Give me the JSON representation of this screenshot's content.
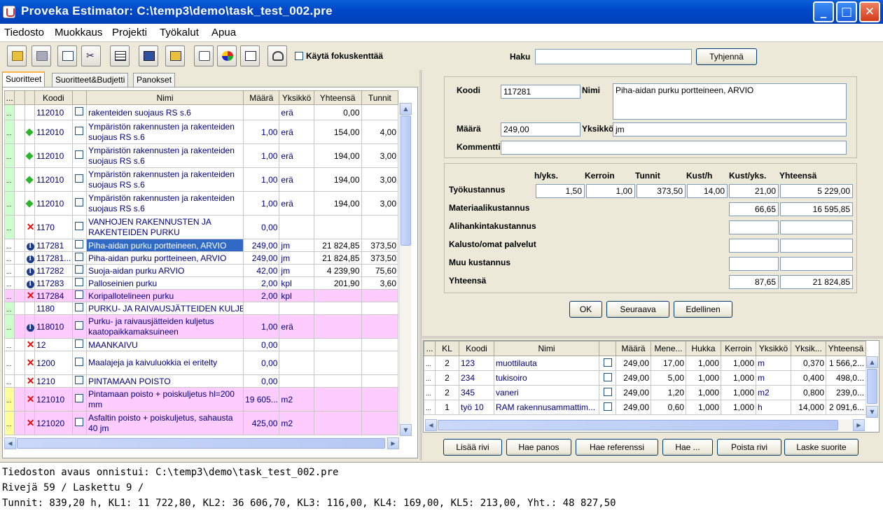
{
  "window": {
    "title": "Proveka Estimator: C:\\temp3\\demo\\task_test_002.pre"
  },
  "menu": [
    "Tiedosto",
    "Muokkaus",
    "Projekti",
    "Työkalut",
    "Apua"
  ],
  "toolbar": {
    "focus_label": "Käytä fokuskenttää",
    "search_label": "Haku",
    "search_value": "",
    "clear_label": "Tyhjennä"
  },
  "tabs": [
    "Suoritteet",
    "Suoritteet&Budjetti",
    "Panokset"
  ],
  "main_table": {
    "columns": [
      "...",
      "",
      "",
      "Koodi",
      "",
      "Nimi",
      "Määrä",
      "Yksikkö",
      "Yhteensä",
      "Tunnit"
    ],
    "rows": [
      {
        "lvl": "g",
        "mark": "",
        "code": "112010",
        "name": "rakenteiden suojaus    RS s.6",
        "qty": "",
        "unit": "erä",
        "total": "0,00",
        "hours": "",
        "pink": false,
        "partial": true
      },
      {
        "lvl": "g",
        "mark": "g",
        "code": "112010",
        "name": "Ympäristön rakennusten ja rakenteiden suojaus    RS s.6",
        "qty": "1,00",
        "unit": "erä",
        "total": "154,00",
        "hours": "4,00",
        "pink": false
      },
      {
        "lvl": "g",
        "mark": "g",
        "code": "112010",
        "name": "Ympäristön rakennusten ja rakenteiden suojaus    RS s.6",
        "qty": "1,00",
        "unit": "erä",
        "total": "194,00",
        "hours": "3,00",
        "pink": false
      },
      {
        "lvl": "g",
        "mark": "g",
        "code": "112010",
        "name": "Ympäristön rakennusten ja rakenteiden suojaus    RS s.6",
        "qty": "1,00",
        "unit": "erä",
        "total": "194,00",
        "hours": "3,00",
        "pink": false
      },
      {
        "lvl": "g",
        "mark": "g",
        "code": "112010",
        "name": "Ympäristön rakennusten ja rakenteiden suojaus    RS s.6",
        "qty": "1,00",
        "unit": "erä",
        "total": "194,00",
        "hours": "3,00",
        "pink": false
      },
      {
        "lvl": "g",
        "mark": "x",
        "code": "1170",
        "name": "VANHOJEN RAKENNUSTEN JA RAKENTEIDEN PURKU",
        "qty": "0,00",
        "unit": "",
        "total": "",
        "hours": "",
        "pink": false
      },
      {
        "lvl": "",
        "mark": "i",
        "code": "117281",
        "name": "Piha-aidan purku portteineen, ARVIO",
        "qty": "249,00",
        "unit": "jm",
        "total": "21 824,85",
        "hours": "373,50",
        "pink": false,
        "selected": true
      },
      {
        "lvl": "",
        "mark": "i",
        "code": "117281...",
        "name": "Piha-aidan purku portteineen, ARVIO",
        "qty": "249,00",
        "unit": "jm",
        "total": "21 824,85",
        "hours": "373,50",
        "pink": false
      },
      {
        "lvl": "",
        "mark": "i",
        "code": "117282",
        "name": "Suoja-aidan purku     ARVIO",
        "qty": "42,00",
        "unit": "jm",
        "total": "4 239,90",
        "hours": "75,60",
        "pink": false
      },
      {
        "lvl": "",
        "mark": "i",
        "code": "117283",
        "name": "Palloseinien purku",
        "qty": "2,00",
        "unit": "kpl",
        "total": "201,90",
        "hours": "3,60",
        "pink": false
      },
      {
        "lvl": "",
        "mark": "x",
        "code": "117284",
        "name": "Koripallotelineen purku",
        "qty": "2,00",
        "unit": "kpl",
        "total": "",
        "hours": "",
        "pink": true
      },
      {
        "lvl": "g",
        "mark": "",
        "code": "1180",
        "name": "PURKU- JA RAIVAUSJÄTTEIDEN KULJETUS",
        "qty": "",
        "unit": "",
        "total": "",
        "hours": "",
        "pink": false
      },
      {
        "lvl": "g",
        "mark": "i",
        "code": "118010",
        "name": "Purku- ja raivausjätteiden kuljetus kaatopaikkamaksuineen",
        "qty": "1,00",
        "unit": "erä",
        "total": "",
        "hours": "",
        "pink": true
      },
      {
        "lvl": "",
        "mark": "x",
        "code": "12",
        "name": "MAANKAIVU",
        "qty": "0,00",
        "unit": "",
        "total": "",
        "hours": "",
        "pink": false
      },
      {
        "lvl": "",
        "mark": "x",
        "code": "1200",
        "name": "Maalajeja ja kaivuluokkia ei eritelty",
        "qty": "0,00",
        "unit": "",
        "total": "",
        "hours": "",
        "pink": false
      },
      {
        "lvl": "",
        "mark": "x",
        "code": "1210",
        "name": "PINTAMAAN POISTO",
        "qty": "0,00",
        "unit": "",
        "total": "",
        "hours": "",
        "pink": false
      },
      {
        "lvl": "y",
        "mark": "x",
        "code": "121010",
        "name": "Pintamaan poisto + poiskuljetus hl=200 mm",
        "qty": "19 605...",
        "unit": "m2",
        "total": "",
        "hours": "",
        "pink": true
      },
      {
        "lvl": "y",
        "mark": "x",
        "code": "121020",
        "name": "Asfaltin poisto + poiskuljetus, sahausta 40 jm",
        "qty": "425,00",
        "unit": "m2",
        "total": "",
        "hours": "",
        "pink": true
      }
    ]
  },
  "detail": {
    "code_label": "Koodi",
    "code": "117281",
    "name_label": "Nimi",
    "name": "Piha-aidan purku portteineen, ARVIO",
    "qty_label": "Määrä",
    "qty": "249,00",
    "unit_label": "Yksikkö",
    "unit": "jm",
    "comment_label": "Kommentti",
    "comment": ""
  },
  "costs": {
    "headers": [
      "h/yks.",
      "Kerroin",
      "Tunnit",
      "Kust/h",
      "Kust/yks.",
      "Yhteensä"
    ],
    "work_label": "Työkustannus",
    "work": [
      "1,50",
      "1,00",
      "373,50",
      "14,00",
      "21,00",
      "5 229,00"
    ],
    "material_label": "Materiaalikustannus",
    "material": [
      "66,65",
      "16 595,85"
    ],
    "sub_label": "Alihankintakustannus",
    "sub": [
      "",
      ""
    ],
    "equip_label": "Kalusto/omat palvelut",
    "equip": [
      "",
      ""
    ],
    "other_label": "Muu kustannus",
    "other": [
      "",
      ""
    ],
    "total_label": "Yhteensä",
    "total": [
      "87,65",
      "21 824,85"
    ]
  },
  "detail_buttons": {
    "ok": "OK",
    "next": "Seuraava",
    "prev": "Edellinen"
  },
  "bottom_table": {
    "columns": [
      "...",
      "KL",
      "Koodi",
      "Nimi",
      "",
      "Määrä",
      "Mene...",
      "Hukka",
      "Kerroin",
      "Yksikkö",
      "Yksik...",
      "Yhteensä"
    ],
    "rows": [
      {
        "kl": "2",
        "code": "123",
        "name": "muottilauta",
        "qty": "249,00",
        "mene": "17,00",
        "hukka": "1,000",
        "kerroin": "1,000",
        "unit": "m",
        "yks": "0,370",
        "total": "1 566,2..."
      },
      {
        "kl": "2",
        "code": "234",
        "name": "tukisoiro",
        "qty": "249,00",
        "mene": "5,00",
        "hukka": "1,000",
        "kerroin": "1,000",
        "unit": "m",
        "yks": "0,400",
        "total": "498,0..."
      },
      {
        "kl": "2",
        "code": "345",
        "name": "vaneri",
        "qty": "249,00",
        "mene": "1,20",
        "hukka": "1,000",
        "kerroin": "1,000",
        "unit": "m2",
        "yks": "0,800",
        "total": "239,0..."
      },
      {
        "kl": "1",
        "code": "työ 10",
        "name": "RAM rakennusammattim...",
        "qty": "249,00",
        "mene": "0,60",
        "hukka": "1,000",
        "kerroin": "1,000",
        "unit": "h",
        "yks": "14,000",
        "total": "2 091,6..."
      }
    ]
  },
  "bottom_buttons": [
    "Lisää rivi",
    "Hae panos",
    "Hae referenssi",
    "Hae ...",
    "Poista rivi",
    "Laske suorite"
  ],
  "status": [
    "Tiedoston avaus onnistui: C:\\temp3\\demo\\task_test_002.pre",
    "Rivejä 59 / Laskettu 9 /",
    "Tunnit: 839,20 h, KL1: 11 722,80, KL2: 36 606,70, KL3: 116,00, KL4: 169,00, KL5: 213,00, Yht.: 48 827,50"
  ]
}
